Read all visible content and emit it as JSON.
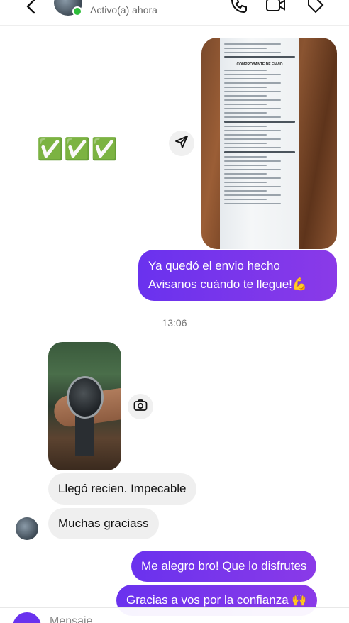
{
  "header": {
    "status": "Activo(a) ahora",
    "icons": [
      "back-arrow-icon",
      "phone-icon",
      "video-camera-icon",
      "tag-icon"
    ]
  },
  "messages": {
    "receipt_lines": [
      "COMPROBANTE DE ENVIO"
    ],
    "emoji_checks": "✅✅✅",
    "out1_line1": "Ya quedó el envio hecho",
    "out1_line2": "Avisanos cuándo te llegue!💪",
    "timestamp": "13:06",
    "in1": "Llegó recien. Impecable",
    "in2": "Muchas graciass",
    "out2": "Me alegro bro! Que lo disfrutes",
    "out3": "Gracias a vos por la confianza 🙌"
  },
  "composer": {
    "placeholder": "Mensaje..."
  },
  "colors": {
    "outgoing_bubble": "#7a36ec",
    "incoming_bubble": "#efefef",
    "online": "#2ebd3a"
  }
}
